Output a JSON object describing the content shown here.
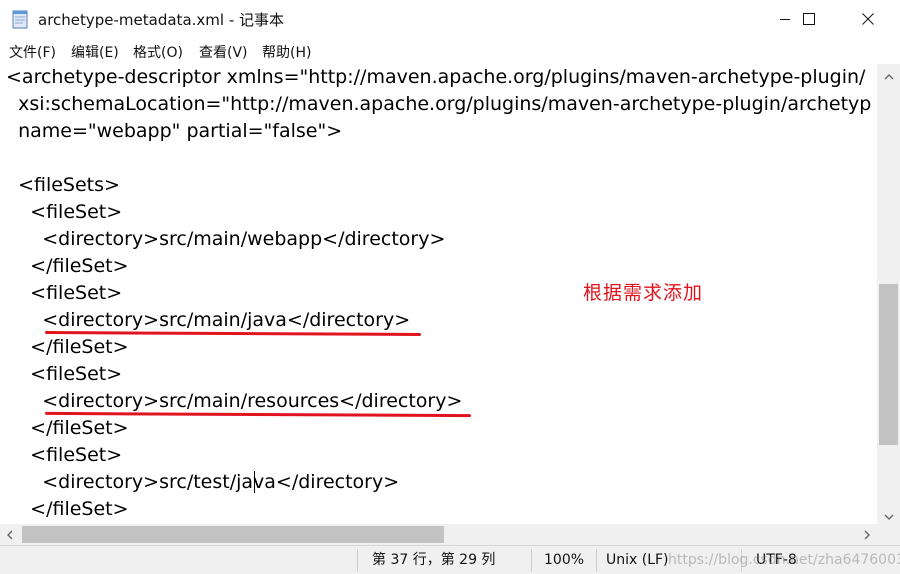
{
  "window": {
    "title": "archetype-metadata.xml - 记事本"
  },
  "menu": {
    "items": [
      "文件(F)",
      "编辑(E)",
      "格式(O)",
      "查看(V)",
      "帮助(H)"
    ]
  },
  "editor": {
    "lines": [
      "<archetype-descriptor xmlns=\"http://maven.apache.org/plugins/maven-archetype-plugin/",
      "  xsi:schemaLocation=\"http://maven.apache.org/plugins/maven-archetype-plugin/archetyp",
      "  name=\"webapp\" partial=\"false\">",
      "",
      "  <fileSets>",
      "    <fileSet>",
      "      <directory>src/main/webapp</directory>",
      "    </fileSet>",
      "    <fileSet>",
      "      <directory>src/main/java</directory>",
      "    </fileSet>",
      "    <fileSet>",
      "      <directory>src/main/resources</directory>",
      "    </fileSet>",
      "    <fileSet>",
      "      <directory>src/test/java</directory>",
      "    </fileSet>"
    ],
    "annotation": "根据需求添加"
  },
  "status": {
    "position": "第 37 行，第 29 列",
    "zoom": "100%",
    "line_ending": "Unix (LF)",
    "encoding": "UTF-8",
    "watermark": "https://blog.csdn.net/zha6476003"
  },
  "colors": {
    "annotation": "#e0141e",
    "scroll_track": "#f0f0f0",
    "scroll_thumb": "#c2c2c2"
  }
}
